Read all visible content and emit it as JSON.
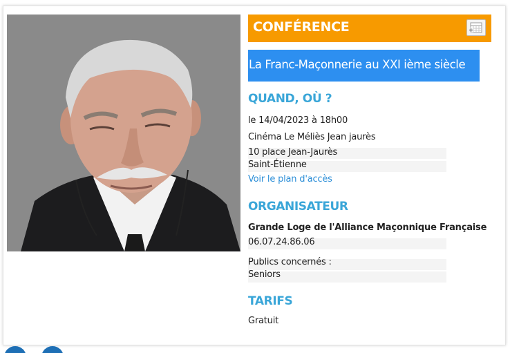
{
  "event": {
    "type_label": "CONFÉRENCE",
    "calendar_icon": "calendar-add-icon",
    "title": "La Franc-Maçonnerie au XXI ième siècle"
  },
  "when_where": {
    "heading": "QUAND, OÙ ?",
    "date": "le 14/04/2023 à 18h00",
    "venue": "Cinéma Le Méliès Jean jaurès",
    "address": "10 place Jean-Jaurès",
    "city": "Saint-Étienne",
    "map_link": "Voir le plan d'accès"
  },
  "organizer": {
    "heading": "ORGANISATEUR",
    "name": "Grande Loge de l'Alliance Maçonnique Française",
    "phone": "06.07.24.86.06",
    "audience_label": "Publics concernés :",
    "audience": "Seniors"
  },
  "pricing": {
    "heading": "TARIFS",
    "price": "Gratuit"
  },
  "colors": {
    "banner": "#f79a00",
    "title_bg": "#2d8ff0",
    "section_heading": "#3aa6d8",
    "link": "#2d8fd8"
  }
}
